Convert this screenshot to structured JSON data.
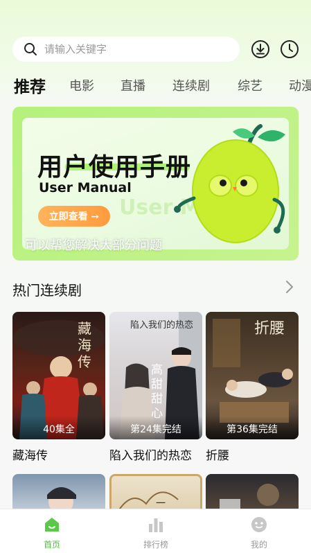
{
  "search": {
    "placeholder": "请输入关键字"
  },
  "tabs": [
    {
      "label": "推荐"
    },
    {
      "label": "电影"
    },
    {
      "label": "直播"
    },
    {
      "label": "连续剧"
    },
    {
      "label": "综艺"
    },
    {
      "label": "动漫"
    }
  ],
  "banner": {
    "title": "用户使用手册",
    "subtitle": "User Manual",
    "watermark": "User Manual",
    "button_label": "立即查看 ➙",
    "caption": "可以帮您解决大部分问题"
  },
  "section": {
    "title": "热门连续剧"
  },
  "cards": [
    {
      "title": "藏海传",
      "episodes": "40集全",
      "poster_text": "藏海传"
    },
    {
      "title": "陷入我们的热恋",
      "episodes": "第24集完结",
      "poster_text": "高甜甜心"
    },
    {
      "title": "折腰",
      "episodes": "第36集完结",
      "poster_text": "折腰"
    }
  ],
  "bottom_nav": [
    {
      "label": "首页",
      "icon": "home-icon"
    },
    {
      "label": "排行榜",
      "icon": "chart-icon"
    },
    {
      "label": "我的",
      "icon": "profile-icon"
    }
  ],
  "colors": {
    "accent": "#4cc23a",
    "banner_green": "#b5f17c",
    "button_orange": "#ff9b3e"
  }
}
